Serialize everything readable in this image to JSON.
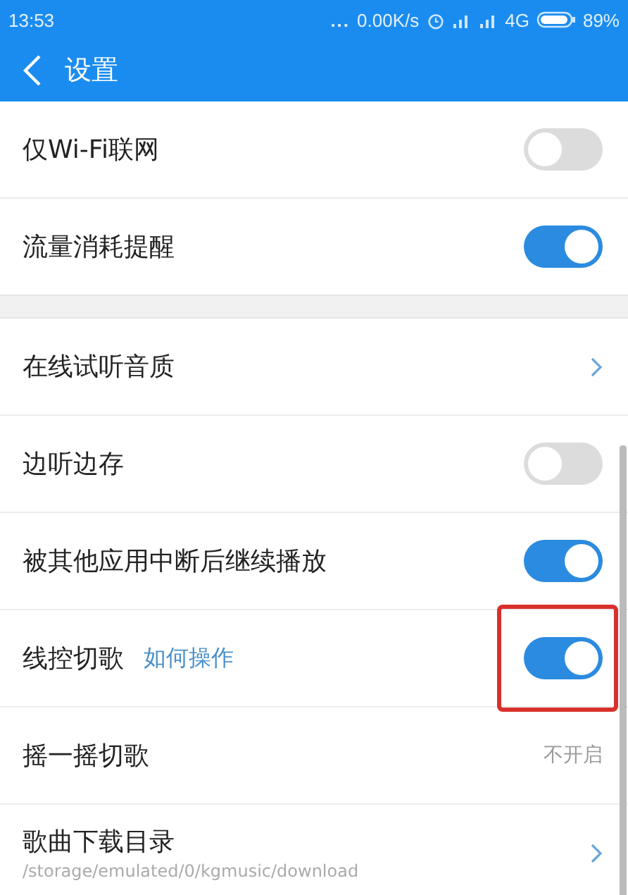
{
  "status_bar": {
    "time": "13:53",
    "dots": "...",
    "speed": "0.00K/s",
    "network": "4G",
    "battery": "89%"
  },
  "header": {
    "title": "设置"
  },
  "groups": [
    {
      "rows": [
        {
          "kind": "toggle",
          "label": "仅Wi-Fi联网",
          "on": false
        },
        {
          "kind": "toggle",
          "label": "流量消耗提醒",
          "on": true
        }
      ]
    },
    {
      "rows": [
        {
          "kind": "chevron",
          "label": "在线试听音质"
        },
        {
          "kind": "toggle",
          "label": "边听边存",
          "on": false
        },
        {
          "kind": "toggle",
          "label": "被其他应用中断后继续播放",
          "on": true
        },
        {
          "kind": "toggle",
          "label": "线控切歌",
          "link": "如何操作",
          "on": true,
          "highlighted": true
        },
        {
          "kind": "value",
          "label": "摇一摇切歌",
          "value": "不开启"
        },
        {
          "kind": "path",
          "label": "歌曲下载目录",
          "path": "/storage/emulated/0/kgmusic/download"
        }
      ]
    }
  ]
}
